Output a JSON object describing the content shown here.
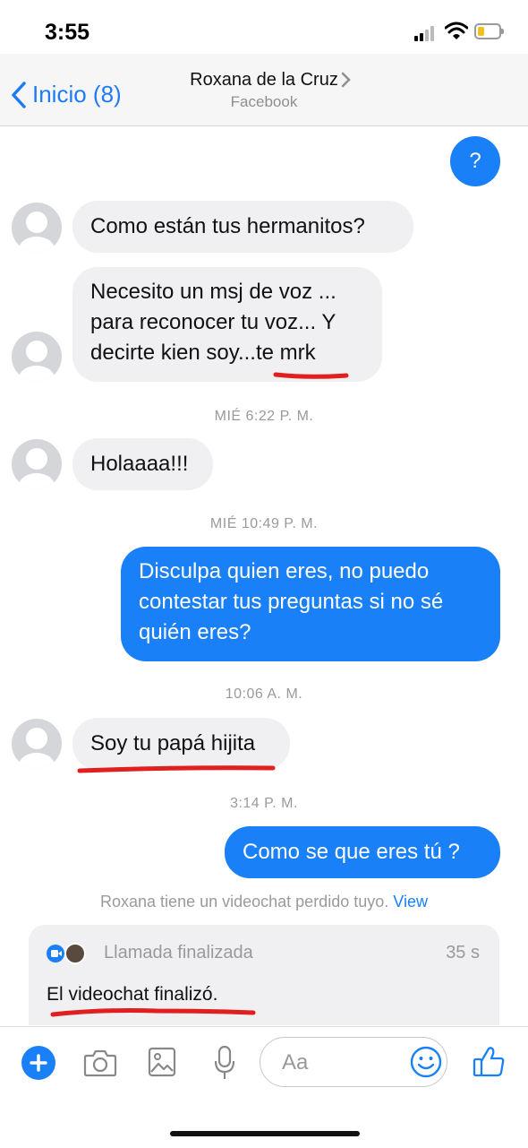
{
  "status_bar": {
    "time": "3:55",
    "battery_level": 0.3
  },
  "header": {
    "back_label": "Inicio (8)",
    "contact_name": "Roxana de la Cruz",
    "contact_subtitle": "Facebook"
  },
  "messages": {
    "top_out": "?",
    "in1": "Como están tus hermanitos?",
    "in2_line1": "Necesito un msj de voz ...",
    "in2_line2": "para reconocer tu voz... Y",
    "in2_line3a": "decirte kien soy...",
    "in2_line3b": "te mrk",
    "ts1": "MIÉ 6:22 P. M.",
    "in3": "Holaaaa!!!",
    "ts2": "MIÉ 10:49 P. M.",
    "out1_line1": "Disculpa quien eres, no puedo",
    "out1_line2": "contestar tus preguntas si no sé",
    "out1_line3": "quién eres?",
    "ts3": "10:06 A. M.",
    "in4": "Soy tu papá hijita",
    "ts4": "3:14 P. M.",
    "out2": "Como se que eres tú ?",
    "missed_text": "Roxana tiene un videochat perdido tuyo.",
    "missed_link": "View"
  },
  "call_card": {
    "title": "Llamada finalizada",
    "duration": "35 s",
    "body": "El videochat finalizó."
  },
  "composer": {
    "placeholder": "Aa"
  },
  "icons": [
    "plus-icon",
    "camera-icon",
    "gallery-icon",
    "microphone-icon",
    "emoji-icon",
    "thumbs-up-icon",
    "video-icon"
  ],
  "colors": {
    "accent": "#1a80f7",
    "annotation_red": "#e01f1f",
    "incoming_bubble": "#f0f0f2"
  }
}
